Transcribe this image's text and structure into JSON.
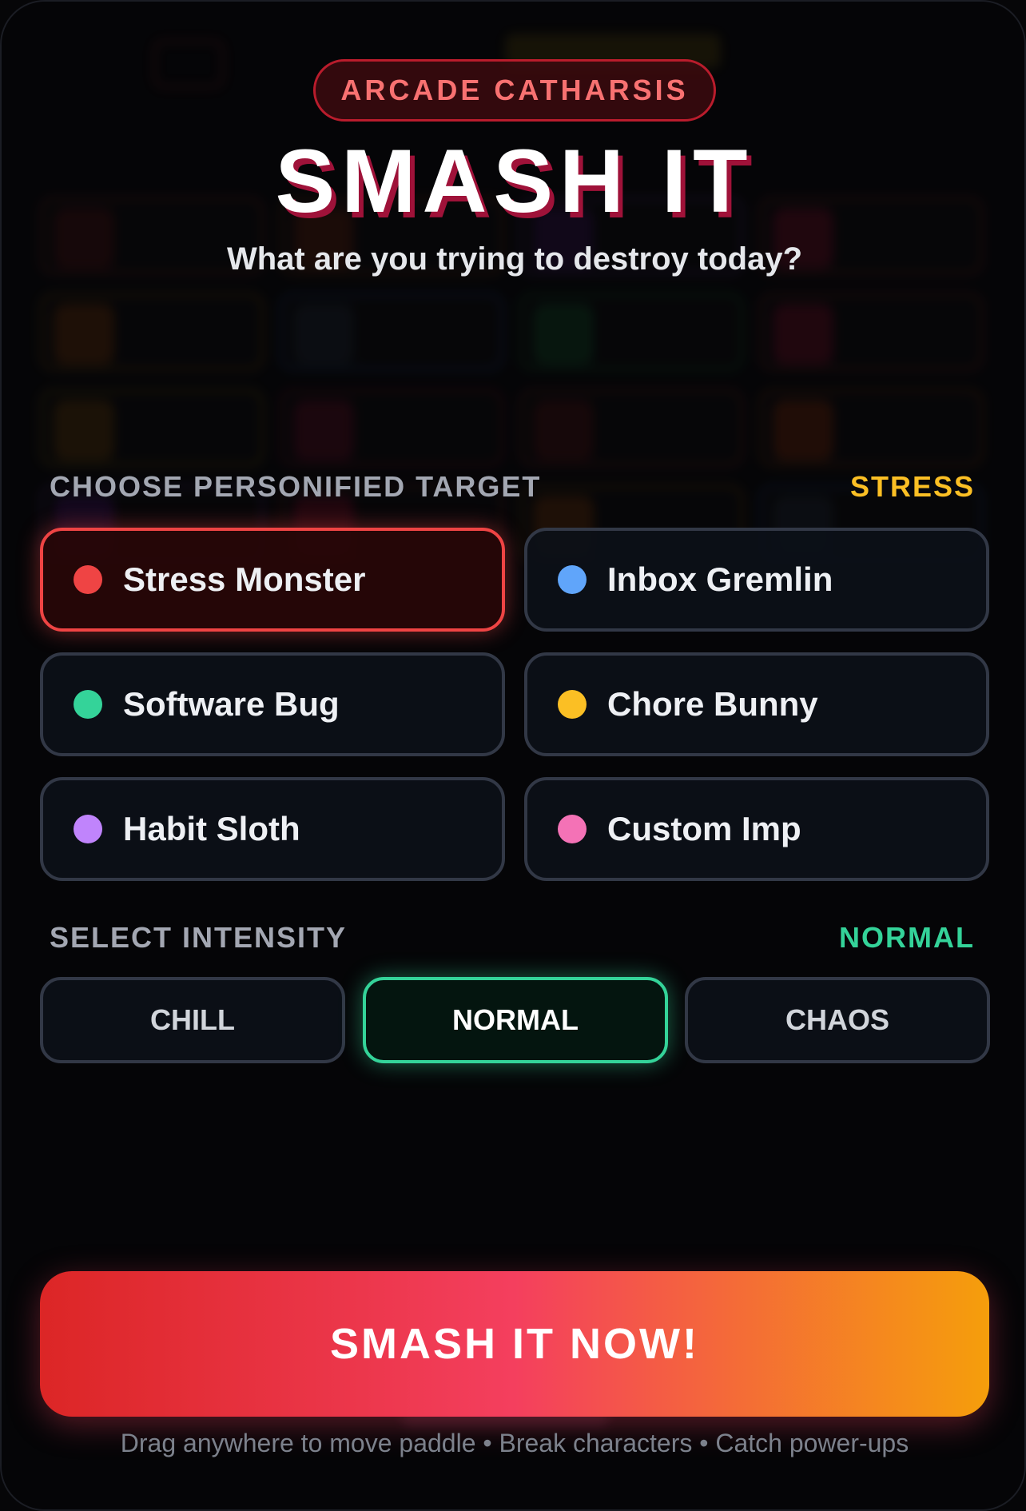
{
  "header": {
    "badge": "ARCADE CATHARSIS",
    "title": "SMASH IT",
    "subtitle": "What are you trying to destroy today?"
  },
  "target_section": {
    "label": "CHOOSE PERSONIFIED TARGET",
    "current_value": "STRESS",
    "value_color": "#fbbf24",
    "options": [
      {
        "label": "Stress Monster",
        "color": "#ef4444",
        "selected": true
      },
      {
        "label": "Inbox Gremlin",
        "color": "#60a5fa",
        "selected": false
      },
      {
        "label": "Software Bug",
        "color": "#34d399",
        "selected": false
      },
      {
        "label": "Chore Bunny",
        "color": "#fbbf24",
        "selected": false
      },
      {
        "label": "Habit Sloth",
        "color": "#c084fc",
        "selected": false
      },
      {
        "label": "Custom Imp",
        "color": "#f472b6",
        "selected": false
      }
    ]
  },
  "intensity_section": {
    "label": "SELECT INTENSITY",
    "current_value": "NORMAL",
    "value_color": "#34d399",
    "options": [
      {
        "label": "CHILL",
        "selected": false
      },
      {
        "label": "NORMAL",
        "selected": true
      },
      {
        "label": "CHAOS",
        "selected": false
      }
    ]
  },
  "cta": {
    "label": "SMASH IT NOW!",
    "hint": "Drag anywhere to move paddle • Break characters • Catch power-ups"
  }
}
